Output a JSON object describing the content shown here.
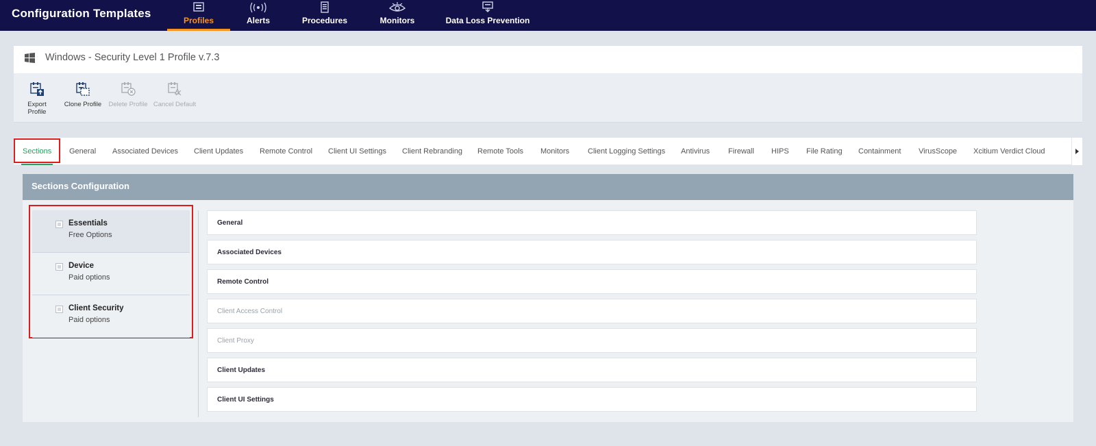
{
  "app": {
    "title": "Configuration Templates"
  },
  "nav": [
    {
      "label": "Profiles",
      "icon": "profiles-icon",
      "active": true
    },
    {
      "label": "Alerts",
      "icon": "alerts-icon"
    },
    {
      "label": "Procedures",
      "icon": "procedures-icon"
    },
    {
      "label": "Monitors",
      "icon": "monitors-icon"
    },
    {
      "label": "Data Loss Prevention",
      "icon": "data-loss-prevention-icon"
    }
  ],
  "profile": {
    "title": "Windows - Security Level 1 Profile v.7.3",
    "icon": "windows-icon"
  },
  "toolbar": {
    "export_label": "Export Profile",
    "clone_label": "Clone Profile",
    "delete_label": "Delete Profile",
    "cancel_default_label": "Cancel Default"
  },
  "tabs": [
    "Sections",
    "General",
    "Associated Devices",
    "Client Updates",
    "Remote Control",
    "Client UI Settings",
    "Client Rebranding",
    "Remote Tools",
    "Monitors",
    "Client Logging Settings",
    "Antivirus",
    "Firewall",
    "HIPS",
    "File Rating",
    "Containment",
    "VirusScope",
    "Xcitium Verdict Cloud"
  ],
  "active_tab": "Sections",
  "sections_config": {
    "header": "Sections Configuration",
    "categories": [
      {
        "title": "Essentials",
        "subtitle": "Free Options",
        "active": true
      },
      {
        "title": "Device",
        "subtitle": "Paid options"
      },
      {
        "title": "Client Security",
        "subtitle": "Paid options"
      }
    ],
    "items": [
      {
        "label": "General",
        "enabled": true
      },
      {
        "label": "Associated Devices",
        "enabled": true
      },
      {
        "label": "Remote Control",
        "enabled": true
      },
      {
        "label": "Client Access Control",
        "enabled": false
      },
      {
        "label": "Client Proxy",
        "enabled": false
      },
      {
        "label": "Client Updates",
        "enabled": true
      },
      {
        "label": "Client UI Settings",
        "enabled": true
      }
    ]
  },
  "colors": {
    "topbar": "#13114a",
    "nav_active": "#f7941d",
    "tab_active": "#2e9c62",
    "highlight": "#e01b1b",
    "section_header": "#93a4b3"
  }
}
